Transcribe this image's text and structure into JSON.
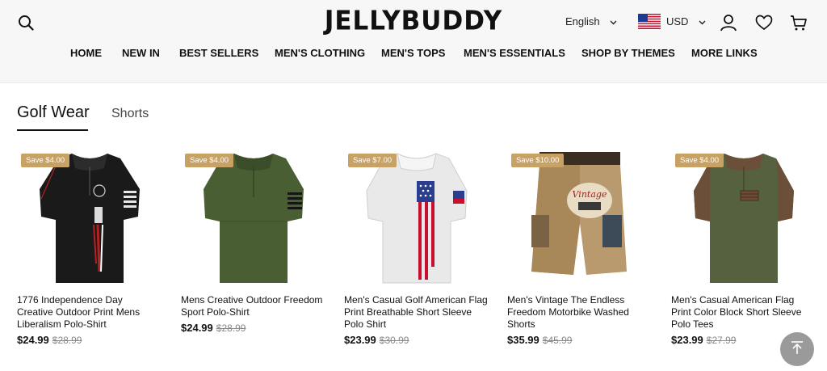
{
  "header": {
    "logo": "JELLYBUDDY",
    "language": "English",
    "currency": "USD",
    "nav": [
      "HOME",
      "NEW IN",
      "BEST SELLERS",
      "MEN'S CLOTHING",
      "MEN'S TOPS",
      "MEN'S ESSENTIALS",
      "SHOP BY THEMES",
      "MORE LINKS"
    ]
  },
  "tabs": {
    "active": "Golf Wear",
    "inactive": "Shorts"
  },
  "products": [
    {
      "badge": "Save $4.00",
      "name": "1776 Independence Day Creative Outdoor Print Mens Liberalism Polo-Shirt",
      "price": "$24.99",
      "old_price": "$28.99"
    },
    {
      "badge": "Save $4.00",
      "name": "Mens Creative Outdoor Freedom Sport Polo-Shirt",
      "price": "$24.99",
      "old_price": "$28.99"
    },
    {
      "badge": "Save $7.00",
      "name": "Men's Casual Golf American Flag Print Breathable Short Sleeve Polo Shirt",
      "price": "$23.99",
      "old_price": "$30.99"
    },
    {
      "badge": "Save $10.00",
      "name": "Men's Vintage The Endless Freedom Motorbike Washed Shorts",
      "price": "$35.99",
      "old_price": "$45.99"
    },
    {
      "badge": "Save $4.00",
      "name": "Men's Casual American Flag Print Color Block Short Sleeve Polo Tees",
      "price": "$23.99",
      "old_price": "$27.99"
    }
  ],
  "icons": {
    "search": "search-icon",
    "account": "user-icon",
    "wishlist": "heart-icon",
    "cart": "cart-icon",
    "language_dropdown": "chevron-down-icon",
    "flag": "us-flag-icon",
    "back_to_top": "arrow-up-icon"
  },
  "colors": {
    "badge": "#c8a165",
    "header_bg": "#f7f7f7",
    "text": "#111111",
    "old_price": "#888888",
    "back_to_top": "#9a9a9a"
  }
}
